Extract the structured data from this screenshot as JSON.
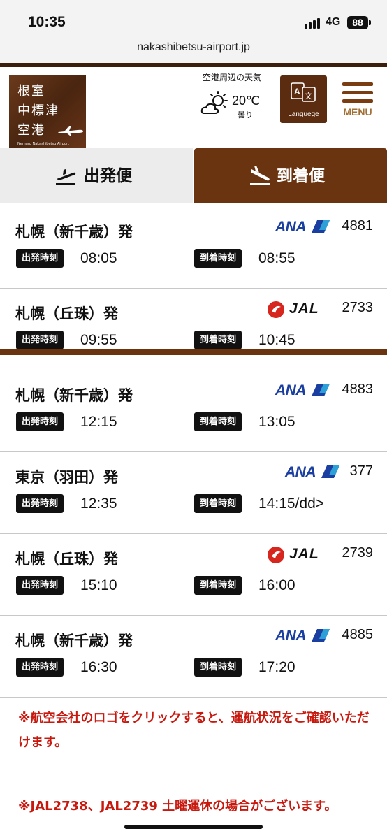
{
  "status": {
    "time": "10:35",
    "network": "4G",
    "battery": "88"
  },
  "browser": {
    "url": "nakashibetsu-airport.jp"
  },
  "header": {
    "logo_lines": [
      "根室",
      "中標津",
      "空港"
    ],
    "logo_sub": "Nemuro Nakashibetsu Airport",
    "weather_title": "空港周辺の天気",
    "temperature": "20℃",
    "condition": "曇り",
    "language_label": "Languege",
    "menu_label": "MENU"
  },
  "tabs": {
    "departures": "出発便",
    "arrivals": "到着便",
    "active": "arrivals"
  },
  "labels": {
    "dep_time": "出発時刻",
    "arr_time": "到着時刻"
  },
  "flights": [
    {
      "origin": "札幌（新千歳）発",
      "airline": "ANA",
      "number": "4881",
      "dep": "08:05",
      "arr": "08:55"
    },
    {
      "origin": "札幌（丘珠）発",
      "airline": "JAL",
      "number": "2733",
      "dep": "09:55",
      "arr": "10:45"
    },
    {
      "origin": "札幌（新千歳）発",
      "airline": "ANA",
      "number": "4883",
      "dep": "12:15",
      "arr": "13:05"
    },
    {
      "origin": "東京（羽田）発",
      "airline": "ANA",
      "number": "377",
      "dep": "12:35",
      "arr": "14:15/dd>"
    },
    {
      "origin": "札幌（丘珠）発",
      "airline": "JAL",
      "number": "2739",
      "dep": "15:10",
      "arr": "16:00"
    },
    {
      "origin": "札幌（新千歳）発",
      "airline": "ANA",
      "number": "4885",
      "dep": "16:30",
      "arr": "17:20"
    }
  ],
  "notes": [
    "※航空会社のロゴをクリックすると、運航状況をご確認いただけます。",
    "※JAL2738、JAL2739 土曜運休の場合がございます。"
  ],
  "colors": {
    "brown": "#6b3410",
    "note_red": "#c8190f",
    "ana_blue": "#1b3fa0",
    "jal_red": "#d7261e"
  }
}
